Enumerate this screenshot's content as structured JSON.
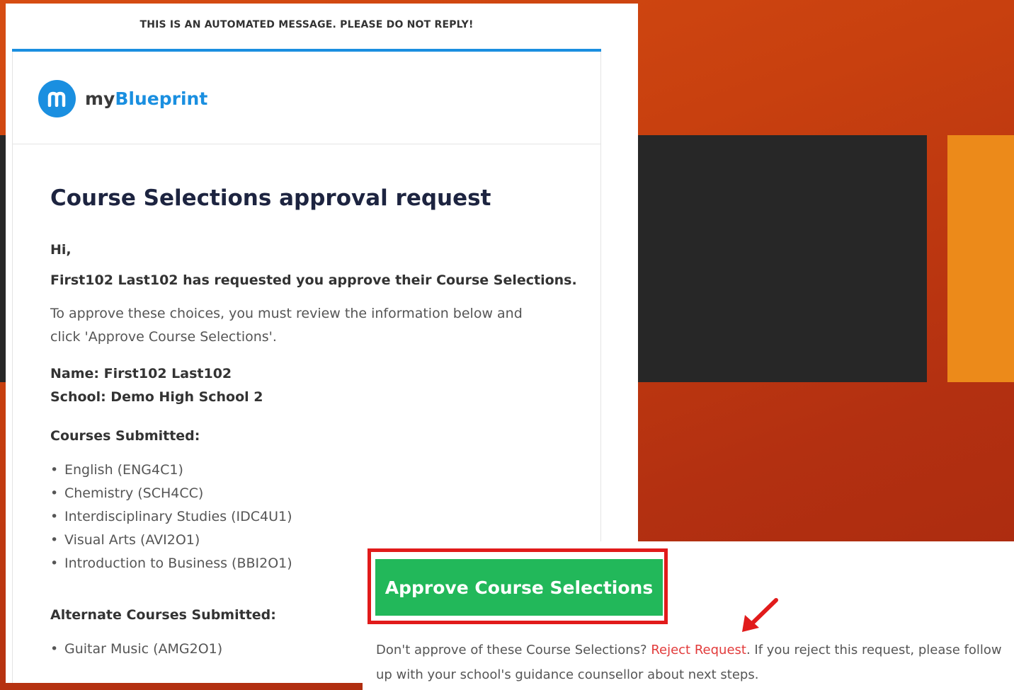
{
  "email": {
    "automated_notice": "THIS IS AN AUTOMATED MESSAGE. PLEASE DO NOT REPLY!",
    "brand": {
      "prefix": "my",
      "name": "Blueprint",
      "icon": "myblueprint-logo-icon"
    },
    "title": "Course Selections approval request",
    "greeting": "Hi,",
    "request_line": "First102 Last102 has requested you approve their Course Selections.",
    "instruction": "To approve these choices, you must review the information below and click 'Approve Course Selections'.",
    "name_line": "Name: First102 Last102",
    "school_line": "School: Demo High School 2",
    "courses_heading": "Courses Submitted:",
    "courses": [
      "English (ENG4C1)",
      "Chemistry (SCH4CC)",
      "Interdisciplinary Studies (IDC4U1)",
      "Visual Arts (AVI2O1)",
      "Introduction to Business (BBI2O1)"
    ],
    "alternate_heading": "Alternate Courses Submitted:",
    "alternates": [
      "Guitar Music (AMG2O1)"
    ]
  },
  "approve": {
    "button_label": "Approve Course Selections",
    "reject_prefix": "Don't approve of these Course Selections? ",
    "reject_link": "Reject Request",
    "reject_suffix": ". If you reject this request, please follow up with your school's guidance counsellor about next steps."
  },
  "colors": {
    "accent_blue": "#1a8fe0",
    "approve_green": "#22b85a",
    "highlight_red": "#e11b1b",
    "background_orange": "#c8400f",
    "dark_panel": "#272727",
    "orange_panel": "#ec8a1a"
  }
}
